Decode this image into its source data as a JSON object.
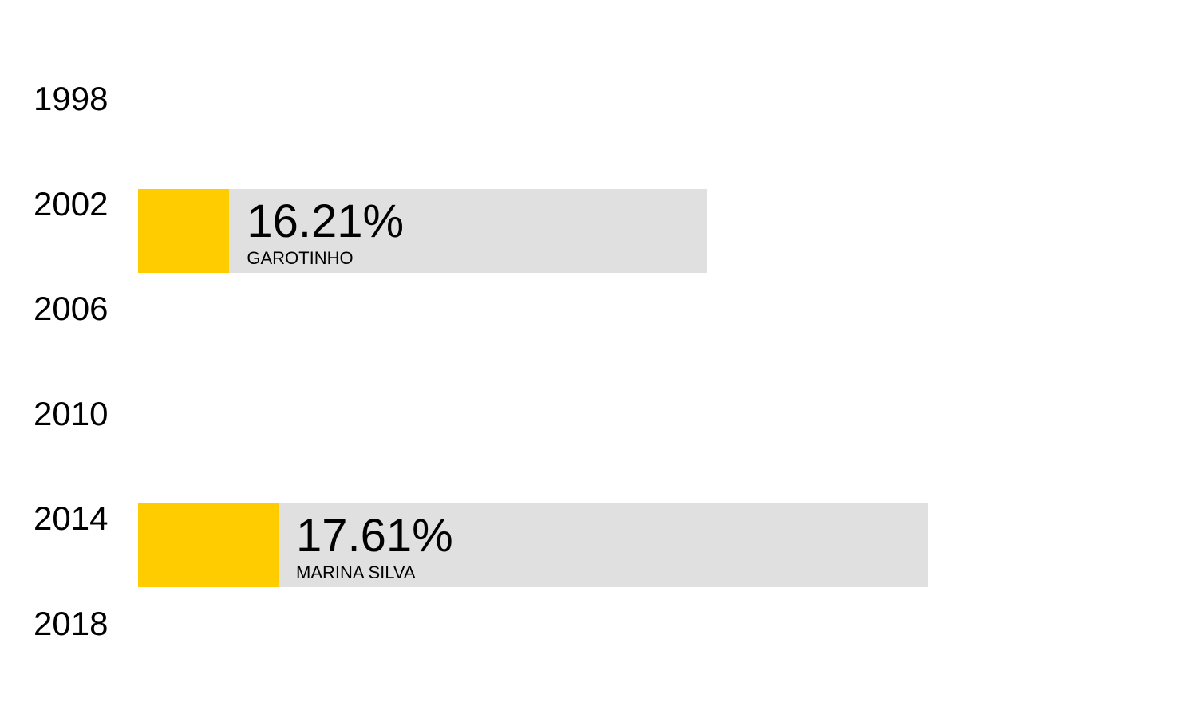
{
  "chart_data": {
    "type": "bar",
    "orientation": "horizontal",
    "categories": [
      "1998",
      "2002",
      "2006",
      "2010",
      "2014",
      "2018"
    ],
    "values": [
      null,
      16.21,
      null,
      null,
      17.61,
      null
    ],
    "value_labels": [
      "",
      "16.21%",
      "",
      "",
      "17.61%",
      ""
    ],
    "candidates": [
      "",
      "GAROTINHO",
      "",
      "",
      "MARINA SILVA",
      ""
    ],
    "ranges": [
      null,
      [
        2.6,
        16.21
      ],
      null,
      null,
      [
        4.0,
        22.5
      ],
      null
    ],
    "colors": {
      "fill": "#ffcc00",
      "track": "#e0e0e0",
      "text": "#000000"
    }
  }
}
